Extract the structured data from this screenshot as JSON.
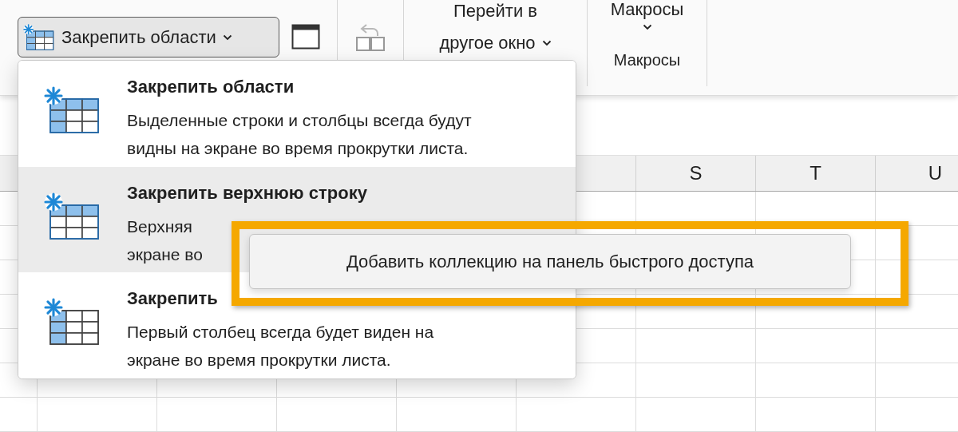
{
  "ribbon": {
    "freeze_button": {
      "label": "Закрепить области",
      "pressed": true
    },
    "switch_windows": {
      "lines": [
        "Перейти в",
        "другое окно"
      ]
    },
    "macros": {
      "label": "Макросы",
      "group_label": "Макросы"
    }
  },
  "columns": [
    "S",
    "T",
    "U"
  ],
  "freeze_menu": {
    "items": [
      {
        "kind": "panes",
        "title": "Закрепить области",
        "description_lines": [
          "Выделенные строки и столбцы всегда будут",
          "видны на экране во время прокрутки листа."
        ],
        "selected": false
      },
      {
        "kind": "top_row",
        "title": "Закрепить верхнюю строку",
        "description_lines": [
          "Верхняя",
          "экране во"
        ],
        "selected": true
      },
      {
        "kind": "first_column",
        "title": "Закрепить",
        "description_lines": [
          "Первый столбец всегда будет виден на",
          "экране во время прокрутки листа."
        ],
        "selected": false
      }
    ]
  },
  "context_menu": {
    "label": "Добавить коллекцию на панель быстрого доступа"
  }
}
